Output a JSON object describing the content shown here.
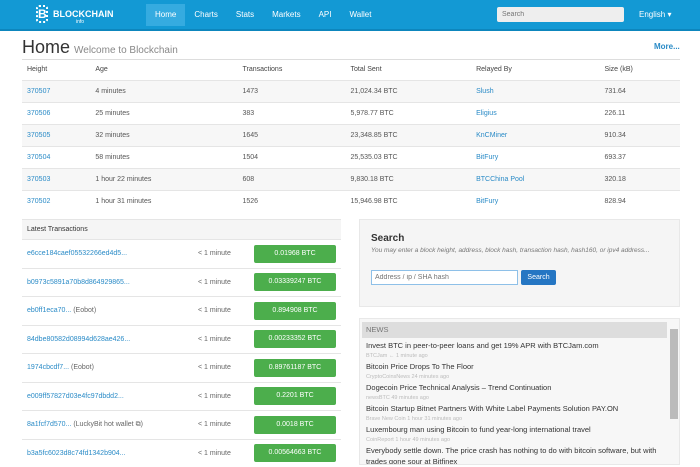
{
  "nav": {
    "logo": "BLOCKCHAIN",
    "logo_sub": "info",
    "items": [
      "Home",
      "Charts",
      "Stats",
      "Markets",
      "API",
      "Wallet"
    ],
    "search_placeholder": "Search",
    "language": "English"
  },
  "header": {
    "title": "Home",
    "subtitle": "Welcome to Blockchain",
    "more": "More..."
  },
  "blocks": {
    "columns": [
      "Height",
      "Age",
      "Transactions",
      "Total Sent",
      "Relayed By",
      "Size (kB)"
    ],
    "rows": [
      [
        "370507",
        "4 minutes",
        "1473",
        "21,024.34 BTC",
        "Slush",
        "731.64"
      ],
      [
        "370506",
        "25 minutes",
        "383",
        "5,978.77 BTC",
        "Eligius",
        "226.11"
      ],
      [
        "370505",
        "32 minutes",
        "1645",
        "23,348.85 BTC",
        "KnCMiner",
        "910.34"
      ],
      [
        "370504",
        "58 minutes",
        "1504",
        "25,535.03 BTC",
        "BitFury",
        "693.37"
      ],
      [
        "370503",
        "1 hour 22 minutes",
        "608",
        "9,830.18 BTC",
        "BTCChina Pool",
        "320.18"
      ],
      [
        "370502",
        "1 hour 31 minutes",
        "1526",
        "15,946.98 BTC",
        "BitFury",
        "828.94"
      ]
    ]
  },
  "transactions": {
    "title": "Latest Transactions",
    "rows": [
      {
        "hash": "e6cce184caef05532266ed4d5...",
        "tag": "",
        "time": "< 1 minute",
        "amount": "0.01968 BTC"
      },
      {
        "hash": "b0973c5891a70b8d864929865...",
        "tag": "",
        "time": "< 1 minute",
        "amount": "0.03339247 BTC"
      },
      {
        "hash": "eb0ff1eca70...",
        "tag": "(Eobot)",
        "time": "< 1 minute",
        "amount": "0.894908 BTC"
      },
      {
        "hash": "84dbe80582d08994d628ae426...",
        "tag": "",
        "time": "< 1 minute",
        "amount": "0.00233352 BTC"
      },
      {
        "hash": "1974cbcdf7...",
        "tag": "(Eobot)",
        "time": "< 1 minute",
        "amount": "0.89761187 BTC"
      },
      {
        "hash": "e009ff57827d03e4fc97dbdd2...",
        "tag": "",
        "time": "< 1 minute",
        "amount": "0.2201 BTC"
      },
      {
        "hash": "8a1fcf7d570...",
        "tag": "(LuckyBit hot wallet ⧉)",
        "time": "< 1 minute",
        "amount": "0.0018 BTC"
      },
      {
        "hash": "b3a5fc6023d8c74fd1342b904...",
        "tag": "",
        "time": "< 1 minute",
        "amount": "0.00564663 BTC"
      }
    ]
  },
  "search": {
    "title": "Search",
    "hint": "You may enter a block height, address, block hash, transaction hash, hash160, or ipv4 address...",
    "placeholder": "Address / ip / SHA hash",
    "button": "Search"
  },
  "news": {
    "title": "NEWS",
    "items": [
      {
        "title": "Invest BTC in peer-to-peer loans and get 19% APR with BTCJam.com",
        "source": "BTCJam ← 1 minute ago"
      },
      {
        "title": "Bitcoin Price Drops To The Floor",
        "source": "CryptoCoinsNews 24 minutes ago"
      },
      {
        "title": "Dogecoin Price Technical Analysis – Trend Continuation",
        "source": "newsBTC 49 minutes ago"
      },
      {
        "title": "Bitcoin Startup Bitnet Partners With White Label Payments Solution PAY.ON",
        "source": "Brave New Coin 1 hour 31 minutes ago"
      },
      {
        "title": "Luxembourg man using Bitcoin to fund year-long international travel",
        "source": "CoinReport 1 hour 49 minutes ago"
      },
      {
        "title": "Everybody settle down. The price crash has nothing to do with bitcoin software, but with trades gone sour at Bitfinex",
        "source": ""
      }
    ]
  }
}
